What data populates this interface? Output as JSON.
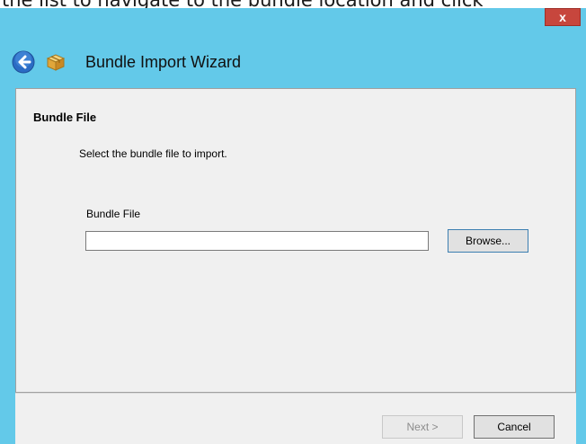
{
  "top_strip": {
    "text": "the list to navigate to the bundle location and click"
  },
  "window": {
    "title": "Bundle Import Wizard",
    "close_label": "x"
  },
  "wizard": {
    "section_title": "Bundle File",
    "instruction": "Select the bundle file to import.",
    "field_label": "Bundle File",
    "field_value": "",
    "browse_label": "Browse..."
  },
  "footer": {
    "next_label": "Next >",
    "cancel_label": "Cancel"
  },
  "colors": {
    "title_bar": "#63c9e9",
    "close_button": "#c7463d",
    "panel": "#f0f0f0"
  }
}
